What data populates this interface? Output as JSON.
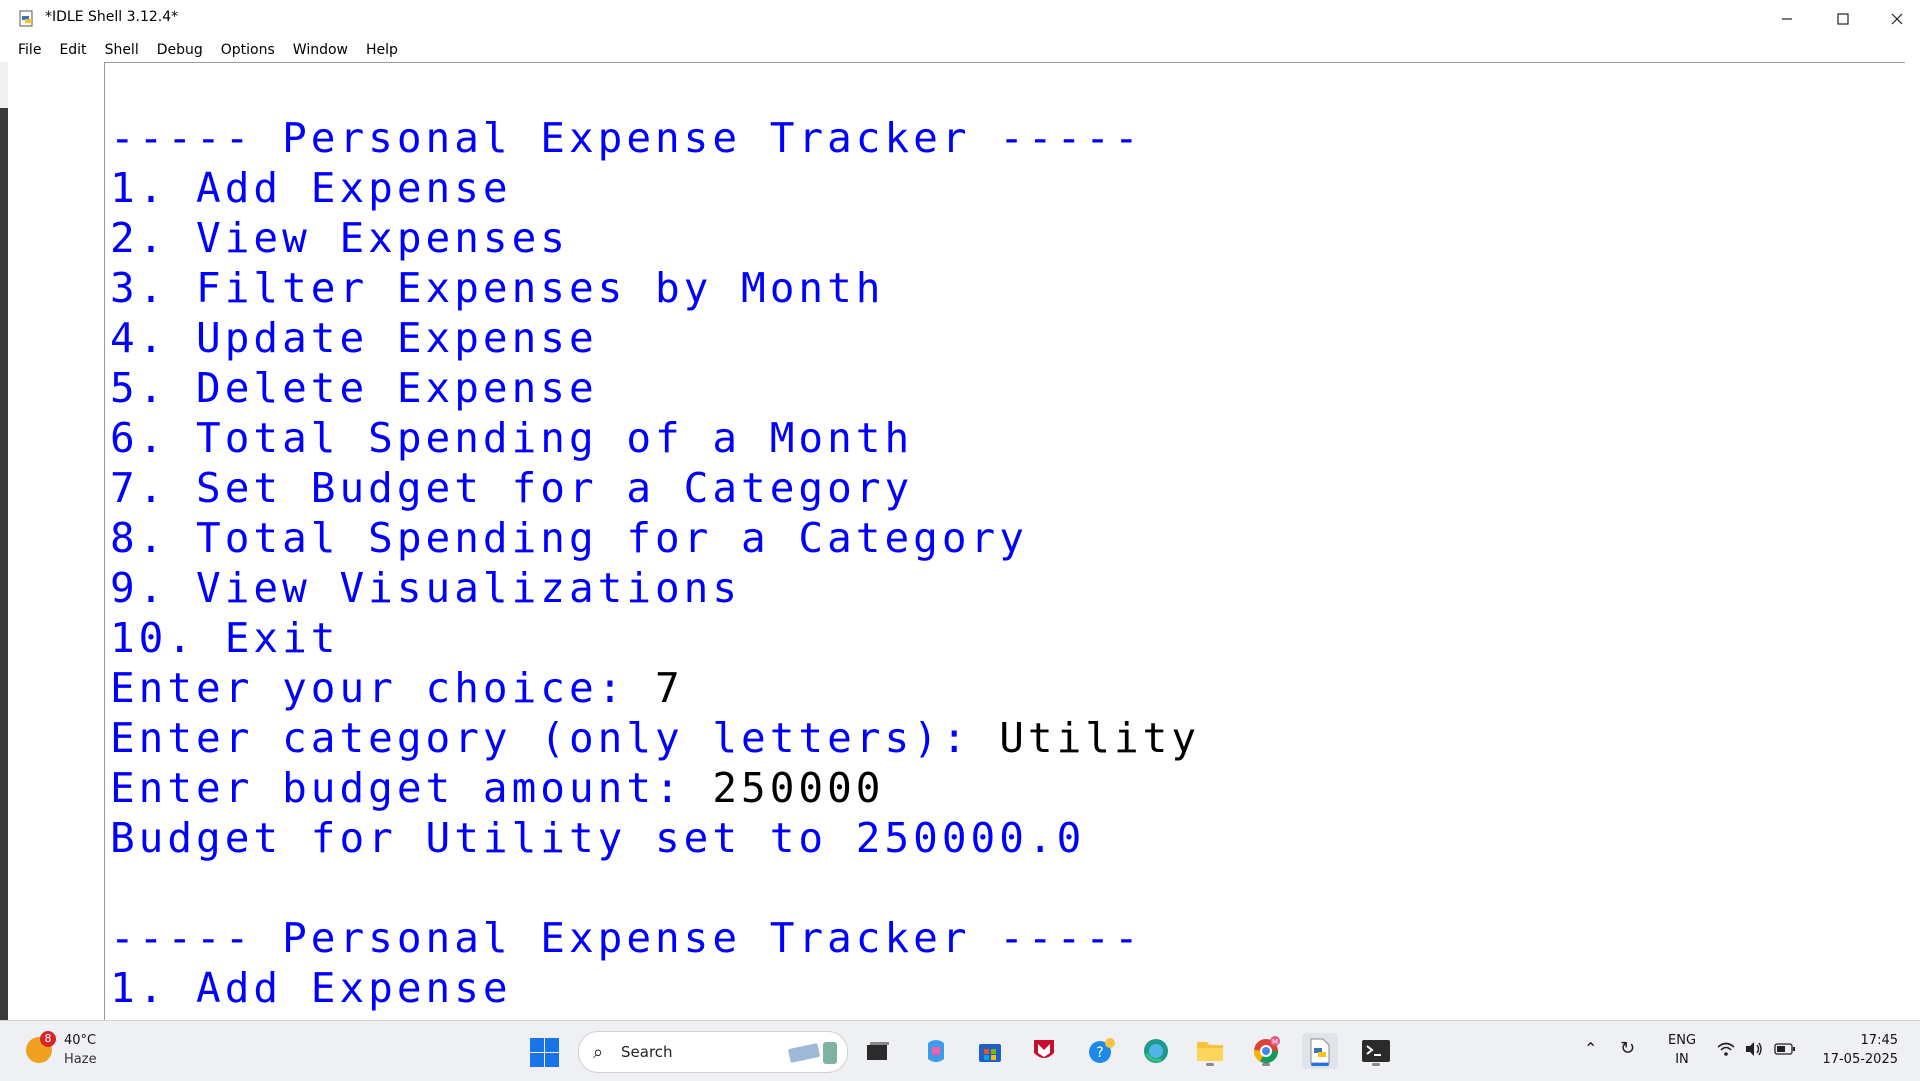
{
  "window": {
    "title": "*IDLE Shell 3.12.4*",
    "controls": [
      "minimize",
      "maximize",
      "close"
    ]
  },
  "menubar": {
    "items": [
      "File",
      "Edit",
      "Shell",
      "Debug",
      "Options",
      "Window",
      "Help"
    ]
  },
  "shell": {
    "lines": [
      {
        "text": "----- Personal Expense Tracker -----",
        "color": "blue"
      },
      {
        "text": "1. Add Expense",
        "color": "blue"
      },
      {
        "text": "2. View Expenses",
        "color": "blue"
      },
      {
        "text": "3. Filter Expenses by Month",
        "color": "blue"
      },
      {
        "text": "4. Update Expense",
        "color": "blue"
      },
      {
        "text": "5. Delete Expense",
        "color": "blue"
      },
      {
        "text": "6. Total Spending of a Month",
        "color": "blue"
      },
      {
        "text": "7. Set Budget for a Category",
        "color": "blue"
      },
      {
        "text": "8. Total Spending for a Category",
        "color": "blue"
      },
      {
        "text": "9. View Visualizations",
        "color": "blue"
      },
      {
        "text": "10. Exit",
        "color": "blue"
      },
      {
        "prompt": "Enter your choice: ",
        "input": "7"
      },
      {
        "prompt": "Enter category (only letters): ",
        "input": "Utility"
      },
      {
        "prompt": "Enter budget amount: ",
        "input": "250000"
      },
      {
        "text": "Budget for Utility set to 250000.0",
        "color": "blue"
      },
      {
        "text": "",
        "color": "blue"
      },
      {
        "text": "----- Personal Expense Tracker -----",
        "color": "blue"
      },
      {
        "text": "1. Add Expense",
        "color": "blue"
      }
    ]
  },
  "taskbar": {
    "weather": {
      "badge": "8",
      "temperature": "40°C",
      "condition": "Haze"
    },
    "search": {
      "label": "Search"
    },
    "apps": [
      "task-view",
      "copilot",
      "microsoft-store",
      "mcafee",
      "get-help",
      "edge",
      "file-explorer",
      "chrome",
      "python-idle",
      "terminal"
    ],
    "tray": {
      "lang_top": "ENG",
      "lang_bottom": "IN",
      "time": "17:45",
      "date": "17-05-2025"
    }
  },
  "colors": {
    "output_blue": "#0000ff",
    "input_black": "#000000",
    "accent": "#1a74e8"
  }
}
